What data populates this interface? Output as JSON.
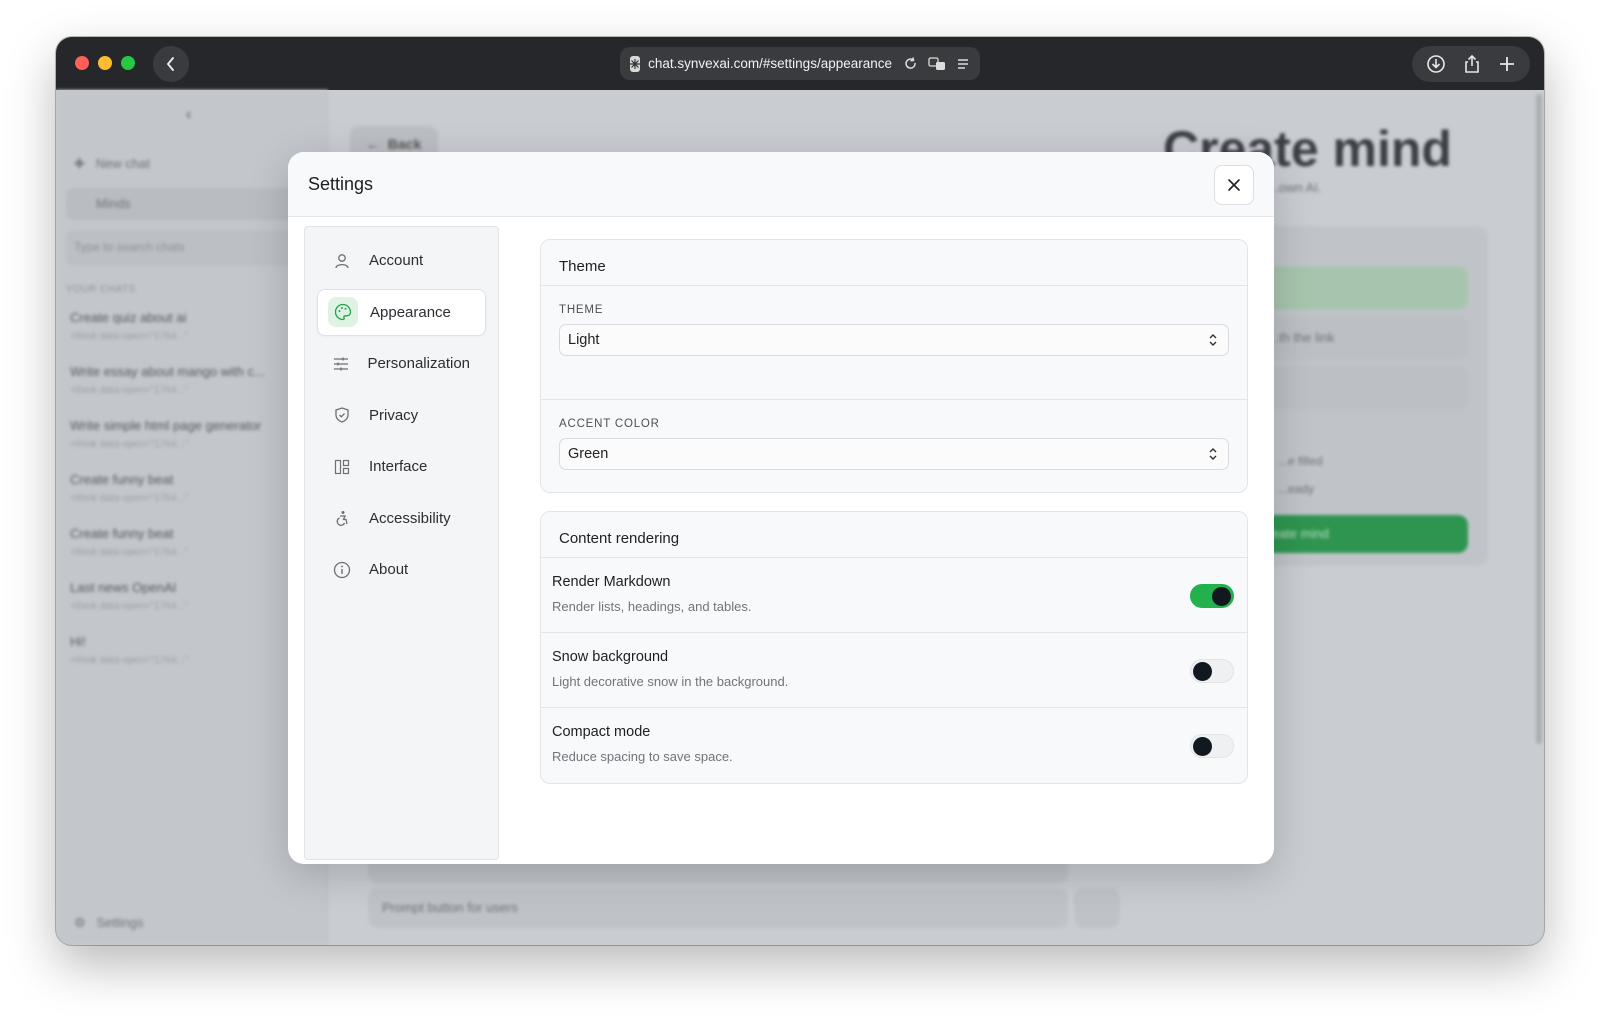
{
  "browser": {
    "url": "chat.synvexai.com/#settings/appearance"
  },
  "background_app": {
    "collapse_glyph": "‹",
    "new_chat": "New chat",
    "minds": "Minds",
    "search_placeholder": "Type to search chats",
    "your_chats": "YOUR CHATS",
    "chats": [
      {
        "title": "Create quiz about ai",
        "sub": "<think data-open=\"1764...\""
      },
      {
        "title": "Write essay about mango with c...",
        "sub": "<think data-open=\"1764...\""
      },
      {
        "title": "Write simple html page generator",
        "sub": "<think data-open=\"1764...\""
      },
      {
        "title": "Create funny beat",
        "sub": "<think data-open=\"1764...\""
      },
      {
        "title": "Create funny beat",
        "sub": "<think data-open=\"1764...\""
      },
      {
        "title": "Last news OpenAI",
        "sub": "<think data-open=\"1764...\""
      },
      {
        "title": "Hi!",
        "sub": "<think data-open=\"1764...\""
      }
    ],
    "settings": "Settings",
    "back": "Back",
    "page_title": "Create mind",
    "page_subtitle": "...own AI.",
    "row_link": "...th the link",
    "note1": "...e filled",
    "note2": "...eady",
    "create_button": "Create mind",
    "prompt_placeholder": "Prompt button for users"
  },
  "modal": {
    "title": "Settings",
    "nav": [
      {
        "label": "Account",
        "icon": "user-icon"
      },
      {
        "label": "Appearance",
        "icon": "palette-icon"
      },
      {
        "label": "Personalization",
        "icon": "sliders-icon"
      },
      {
        "label": "Privacy",
        "icon": "shield-icon"
      },
      {
        "label": "Interface",
        "icon": "layout-icon"
      },
      {
        "label": "Accessibility",
        "icon": "accessibility-icon"
      },
      {
        "label": "About",
        "icon": "info-icon"
      }
    ],
    "active_nav": "Appearance",
    "theme_card": {
      "heading": "Theme",
      "theme_label": "THEME",
      "theme_value": "Light",
      "accent_label": "ACCENT COLOR",
      "accent_value": "Green"
    },
    "content_card": {
      "heading": "Content rendering",
      "rows": [
        {
          "title": "Render Markdown",
          "desc": "Render lists, headings, and tables.",
          "enabled": true
        },
        {
          "title": "Snow background",
          "desc": "Light decorative snow in the background.",
          "enabled": false
        },
        {
          "title": "Compact mode",
          "desc": "Reduce spacing to save space.",
          "enabled": false
        }
      ]
    }
  },
  "colors": {
    "accent": "#22b14c",
    "accent_tint": "#dff3e5"
  }
}
